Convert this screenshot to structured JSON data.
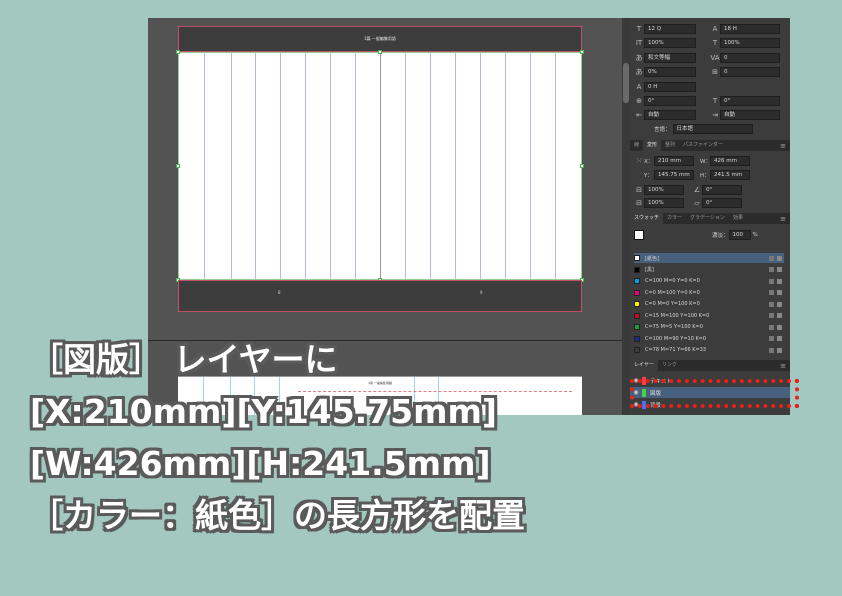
{
  "canvas": {
    "header_text": "1篇 一般編集用語",
    "page_left": "8",
    "page_right": "9",
    "page2_header": "1篇 一般編集用語"
  },
  "character_panel": {
    "font_size": "12 Q",
    "leading": "18 H",
    "vertical_scale": "100%",
    "horizontal_scale": "100%",
    "mojikumi": "和文等幅",
    "tracking": "0",
    "tsume": "0%",
    "aki": "0",
    "baseline": "0 H",
    "rotation": "0°",
    "skew": "0°",
    "aki_before": "自動",
    "aki_after": "自動",
    "language_label": "言語：",
    "language": "日本語"
  },
  "transform_panel": {
    "tabs": [
      "線",
      "変形",
      "整列",
      "パスファインダー"
    ],
    "x_label": "X：",
    "x": "210 mm",
    "y_label": "Y：",
    "y": "145.75 mm",
    "w_label": "W：",
    "w": "426 mm",
    "h_label": "H：",
    "h": "241.5 mm",
    "scale_x": "100%",
    "scale_y": "100%",
    "angle": "0°",
    "shear": "0°"
  },
  "swatches_panel": {
    "tabs": [
      "スウォッチ",
      "カラー",
      "グラデーション",
      "効果"
    ],
    "tint_label": "濃淡：",
    "tint": "100",
    "tint_unit": "%",
    "items": [
      {
        "name": "[紙色]",
        "color": "#ffffff"
      },
      {
        "name": "[黒]",
        "color": "#000000"
      },
      {
        "name": "C=100 M=0 Y=0 K=0",
        "color": "#00a0e9"
      },
      {
        "name": "C=0 M=100 Y=0 K=0",
        "color": "#e4007f"
      },
      {
        "name": "C=0 M=0 Y=100 K=0",
        "color": "#fff100"
      },
      {
        "name": "C=15 M=100 Y=100 K=0",
        "color": "#c30d23"
      },
      {
        "name": "C=75 M=5 Y=100 K=0",
        "color": "#1aa33a"
      },
      {
        "name": "C=100 M=90 Y=10 K=0",
        "color": "#1d2a88"
      },
      {
        "name": "C=78 M=71 Y=66 K=33",
        "color": "#3a3a3a"
      }
    ]
  },
  "layers_panel": {
    "tabs": [
      "レイヤー",
      "リンク"
    ],
    "layers": [
      {
        "name": "テキスト",
        "color": "#ff4040"
      },
      {
        "name": "図版",
        "color": "#4ad04a"
      },
      {
        "name": "背景",
        "color": "#4a70ff"
      }
    ]
  },
  "caption": {
    "line1": "［図版］ レイヤーに",
    "line2": "[X:210mm][Y:145.75mm]",
    "line3": "[W:426mm][H:241.5mm]",
    "line4": "［カラー：紙色］の長方形を配置"
  },
  "colors": {
    "highlight": "#e2231a",
    "background": "#a2c8bf"
  }
}
